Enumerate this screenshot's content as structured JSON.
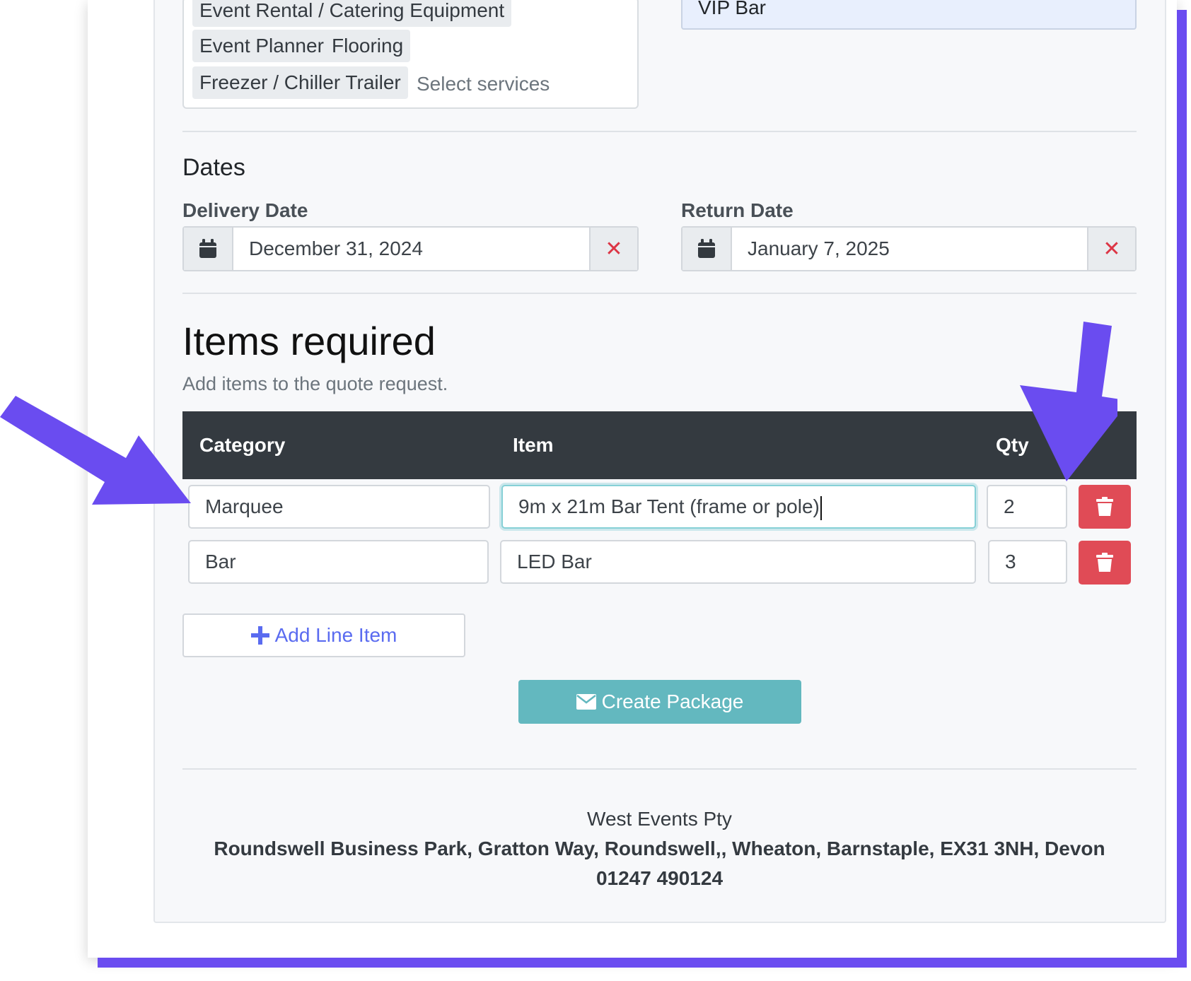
{
  "services": {
    "chips": [
      "Event Rental / Catering Equipment",
      "Event Planner",
      "Flooring",
      "Freezer / Chiller Trailer"
    ],
    "placeholder": "Select services"
  },
  "bar_selection": {
    "value": "VIP Bar"
  },
  "dates": {
    "heading": "Dates",
    "delivery": {
      "label": "Delivery Date",
      "value": "December 31, 2024",
      "clear_icon": "times-icon",
      "calendar_icon": "calendar-icon"
    },
    "return": {
      "label": "Return Date",
      "value": "January 7, 2025",
      "clear_icon": "times-icon",
      "calendar_icon": "calendar-icon"
    }
  },
  "items": {
    "heading": "Items required",
    "subheading": "Add items to the quote request.",
    "columns": [
      "Category",
      "Item",
      "Qty"
    ],
    "rows": [
      {
        "category": "Marquee",
        "item": "9m x 21m Bar Tent (frame or pole)",
        "qty": "2",
        "focused": true
      },
      {
        "category": "Bar",
        "item": "LED Bar",
        "qty": "3",
        "focused": false
      }
    ],
    "add_label": "Add Line Item",
    "create_label": "Create Package"
  },
  "footer": {
    "company": "West Events Pty",
    "address": "Roundswell Business Park, Gratton Way, Roundswell,, Wheaton, Barnstaple, EX31 3NH, Devon",
    "phone": "01247 490124"
  },
  "colors": {
    "accent_arrow": "#6a4cf0",
    "danger": "#e04b56",
    "primary_link": "#5a6bf0",
    "create_button": "#63b8bf",
    "table_header": "#343a40"
  }
}
